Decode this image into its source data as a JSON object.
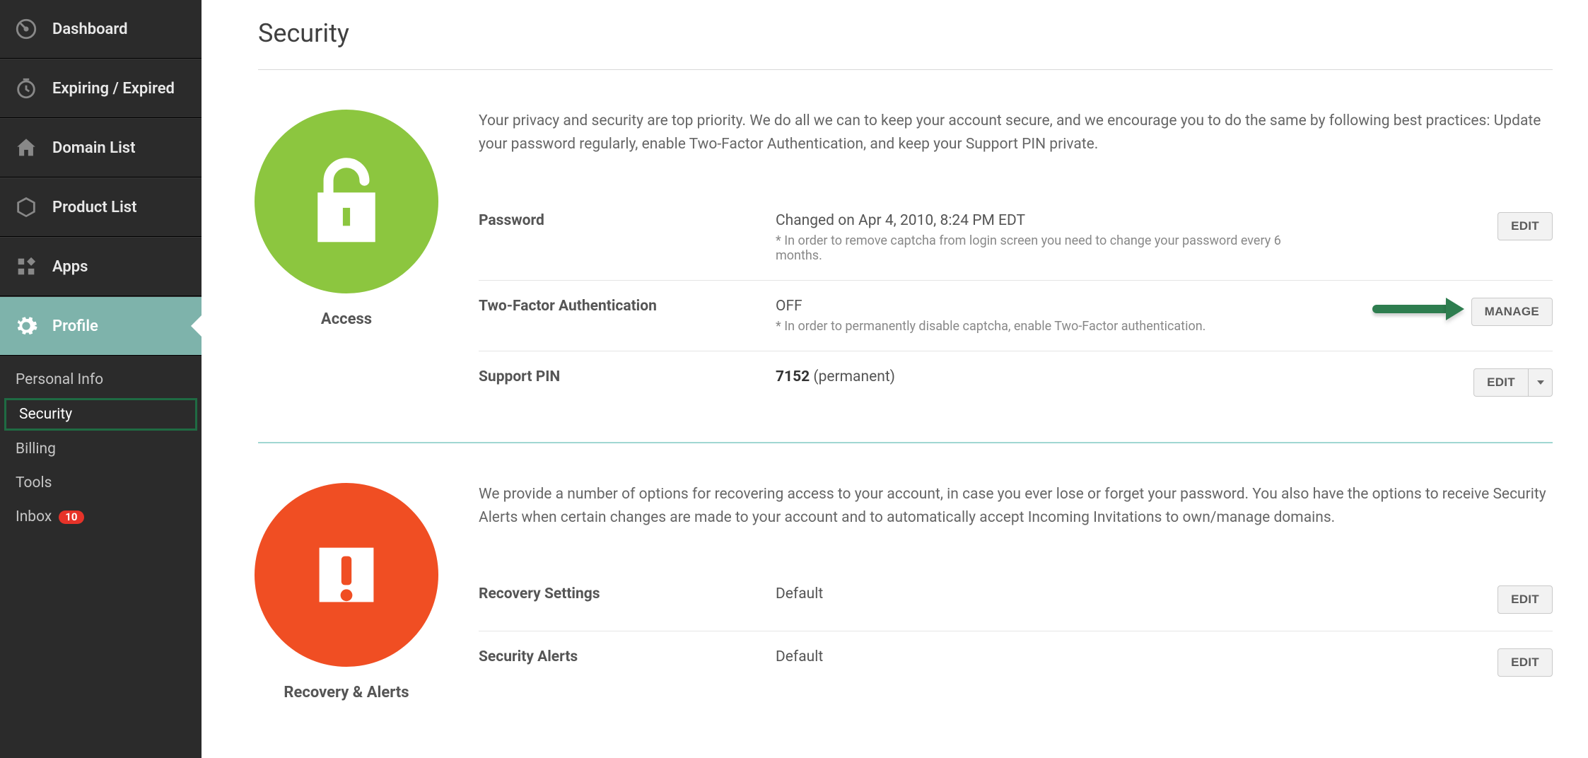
{
  "sidebar": {
    "items": [
      {
        "label": "Dashboard"
      },
      {
        "label": "Expiring / Expired"
      },
      {
        "label": "Domain List"
      },
      {
        "label": "Product List"
      },
      {
        "label": "Apps"
      },
      {
        "label": "Profile"
      }
    ],
    "sub": [
      {
        "label": "Personal Info"
      },
      {
        "label": "Security"
      },
      {
        "label": "Billing"
      },
      {
        "label": "Tools"
      },
      {
        "label": "Inbox",
        "badge": "10"
      }
    ]
  },
  "page": {
    "title": "Security"
  },
  "access": {
    "title": "Access",
    "intro": "Your privacy and security are top priority. We do all we can to keep your account secure, and we encourage you to do the same by following best practices: Update your password regularly, enable Two-Factor Authentication, and keep your Support PIN private.",
    "password": {
      "label": "Password",
      "value": "Changed on Apr 4, 2010, 8:24 PM EDT",
      "note": "* In order to remove captcha from login screen you need to change your password every 6 months.",
      "button": "EDIT"
    },
    "tfa": {
      "label": "Two-Factor Authentication",
      "value": "OFF",
      "note": "* In order to permanently disable captcha, enable Two-Factor authentication.",
      "button": "MANAGE"
    },
    "pin": {
      "label": "Support PIN",
      "value": "7152",
      "suffix": " (permanent)",
      "button": "EDIT"
    }
  },
  "recovery": {
    "title": "Recovery & Alerts",
    "intro": "We provide a number of options for recovering access to your account, in case you ever lose or forget your password. You also have the options to receive Security Alerts when certain changes are made to your account and to automatically accept Incoming Invitations to own/manage domains.",
    "settings": {
      "label": "Recovery Settings",
      "value": "Default",
      "button": "EDIT"
    },
    "alerts": {
      "label": "Security Alerts",
      "value": "Default",
      "button": "EDIT"
    }
  }
}
